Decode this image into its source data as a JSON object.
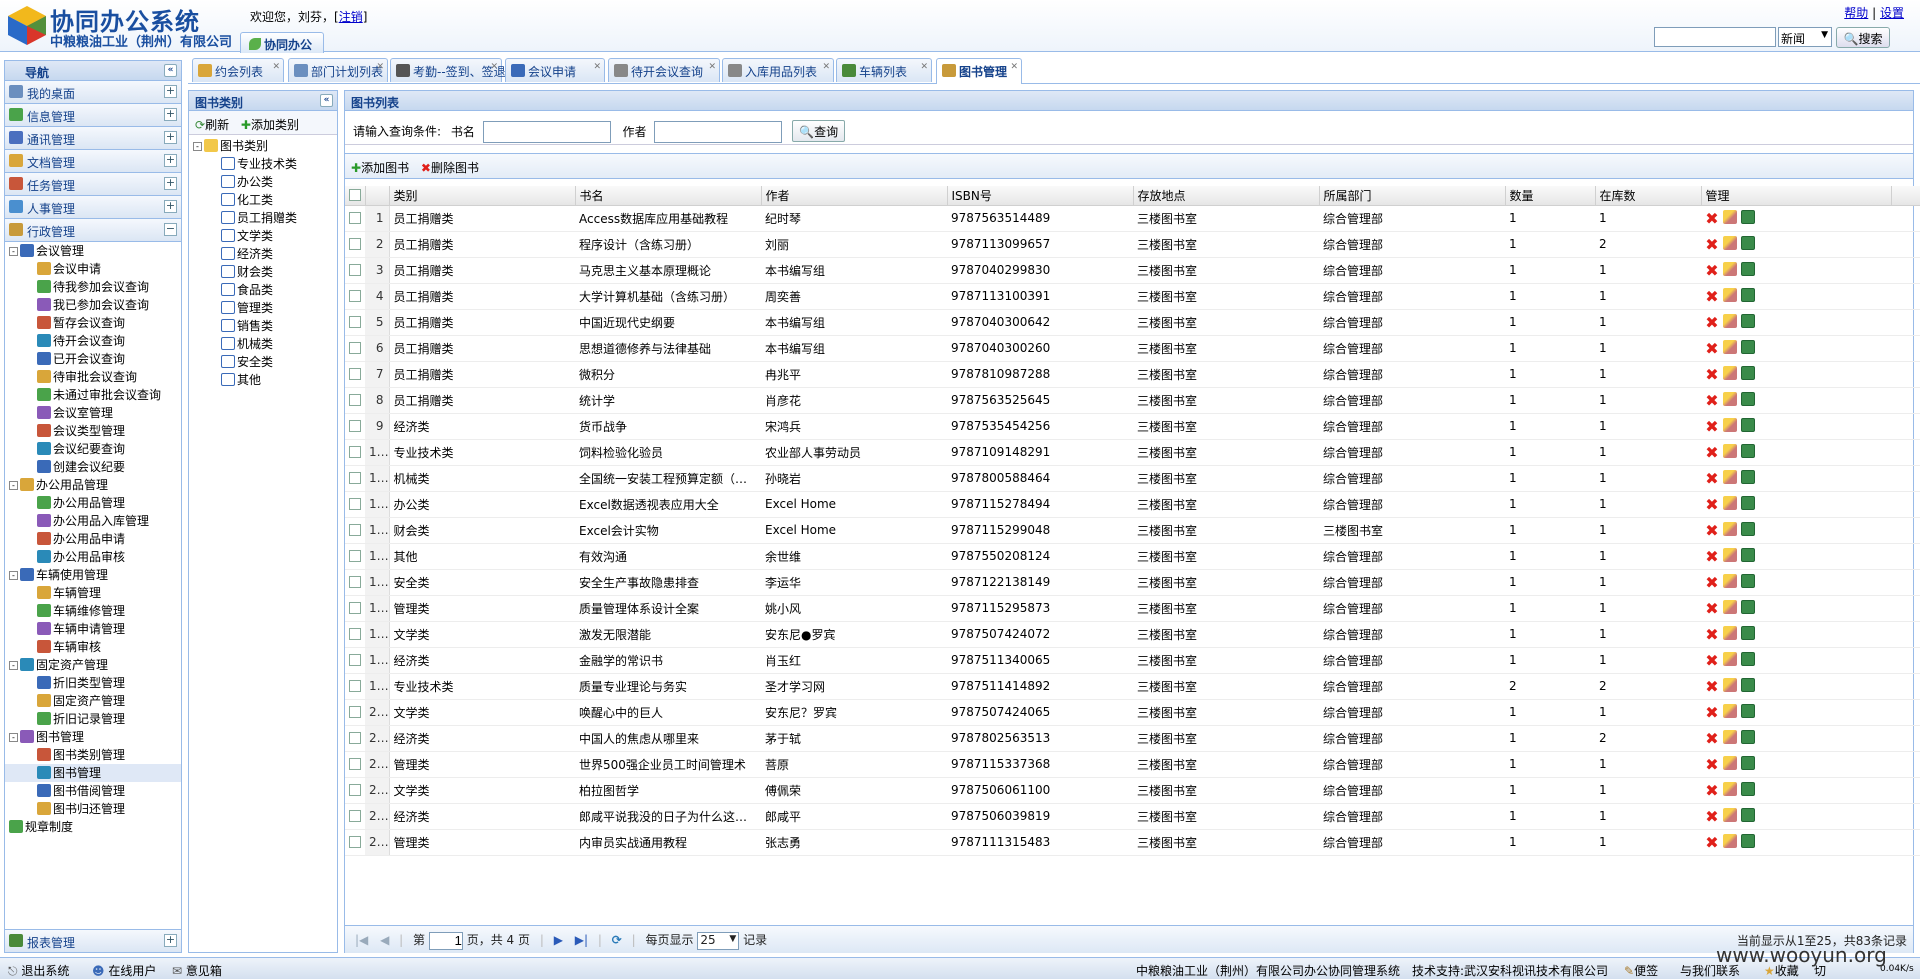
{
  "header": {
    "app_title": "协同办公系统",
    "company": "中粮粮油工业（荆州）有限公司",
    "welcome_prefix": "欢迎您，刘芬，[",
    "logout": "注销",
    "welcome_suffix": "]",
    "top_tab": "协同办公",
    "help": "帮助",
    "separator": "|",
    "settings": "设置",
    "search_placeholder": "",
    "search_scope": "新闻",
    "search_button": "搜索"
  },
  "nav": {
    "title": "导航",
    "sections": [
      {
        "label": "我的桌面",
        "icon": "desktop-icon",
        "color": "#6b8fbf"
      },
      {
        "label": "信息管理",
        "icon": "chat-icon",
        "color": "#4aa34a"
      },
      {
        "label": "通讯管理",
        "icon": "phone-icon",
        "color": "#4a6fbf"
      },
      {
        "label": "文档管理",
        "icon": "folder-icon",
        "color": "#d9a63a"
      },
      {
        "label": "任务管理",
        "icon": "task-icon",
        "color": "#c8563a"
      },
      {
        "label": "人事管理",
        "icon": "people-icon",
        "color": "#4a8fcf"
      },
      {
        "label": "行政管理",
        "icon": "book-icon",
        "color": "#c89a3a",
        "expanded": true
      }
    ],
    "tree": [
      {
        "label": "会议管理",
        "level": 1,
        "toggle": "-"
      },
      {
        "label": "会议申请",
        "level": 2
      },
      {
        "label": "待我参加会议查询",
        "level": 2
      },
      {
        "label": "我已参加会议查询",
        "level": 2
      },
      {
        "label": "暂存会议查询",
        "level": 2
      },
      {
        "label": "待开会议查询",
        "level": 2
      },
      {
        "label": "已开会议查询",
        "level": 2
      },
      {
        "label": "待审批会议查询",
        "level": 2
      },
      {
        "label": "未通过审批会议查询",
        "level": 2
      },
      {
        "label": "会议室管理",
        "level": 2
      },
      {
        "label": "会议类型管理",
        "level": 2
      },
      {
        "label": "会议纪要查询",
        "level": 2
      },
      {
        "label": "创建会议纪要",
        "level": 2
      },
      {
        "label": "办公用品管理",
        "level": 1,
        "toggle": "-"
      },
      {
        "label": "办公用品管理",
        "level": 2
      },
      {
        "label": "办公用品入库管理",
        "level": 2
      },
      {
        "label": "办公用品申请",
        "level": 2
      },
      {
        "label": "办公用品审核",
        "level": 2
      },
      {
        "label": "车辆使用管理",
        "level": 1,
        "toggle": "-"
      },
      {
        "label": "车辆管理",
        "level": 2
      },
      {
        "label": "车辆维修管理",
        "level": 2
      },
      {
        "label": "车辆申请管理",
        "level": 2
      },
      {
        "label": "车辆审核",
        "level": 2
      },
      {
        "label": "固定资产管理",
        "level": 1,
        "toggle": "-"
      },
      {
        "label": "折旧类型管理",
        "level": 2
      },
      {
        "label": "固定资产管理",
        "level": 2
      },
      {
        "label": "折旧记录管理",
        "level": 2
      },
      {
        "label": "图书管理",
        "level": 1,
        "toggle": "-"
      },
      {
        "label": "图书类别管理",
        "level": 2
      },
      {
        "label": "图书管理",
        "level": 2,
        "selected": true
      },
      {
        "label": "图书借阅管理",
        "level": 2
      },
      {
        "label": "图书归还管理",
        "level": 2
      },
      {
        "label": "规章制度",
        "level": 1
      }
    ],
    "bottom_section": "报表管理"
  },
  "tabs": [
    "约会列表",
    "部门计划列表",
    "考勤--签到、签退",
    "会议申请",
    "待开会议查询",
    "入库用品列表",
    "车辆列表",
    "图书管理"
  ],
  "category": {
    "title": "图书类别",
    "refresh": "刷新",
    "add": "添加类别",
    "root": "图书类别",
    "items": [
      "专业技术类",
      "办公类",
      "化工类",
      "员工捐赠类",
      "文学类",
      "经济类",
      "财会类",
      "食品类",
      "管理类",
      "销售类",
      "机械类",
      "安全类",
      "其他"
    ]
  },
  "main": {
    "title": "图书列表",
    "query_label": "请输入查询条件:",
    "name_label": "书名",
    "author_label": "作者",
    "name_value": "",
    "author_value": "",
    "query_button": "查询",
    "add_book": "添加图书",
    "delete_book": "删除图书",
    "columns": [
      "类别",
      "书名",
      "作者",
      "ISBN号",
      "存放地点",
      "所属部门",
      "数量",
      "在库数",
      "管理"
    ],
    "rows": [
      [
        "员工捐赠类",
        "Access数据库应用基础教程",
        "纪时琴",
        "9787563514489",
        "三楼图书室",
        "综合管理部",
        "1",
        "1"
      ],
      [
        "员工捐赠类",
        "程序设计（含练习册）",
        "刘丽",
        "9787113099657",
        "三楼图书室",
        "综合管理部",
        "1",
        "2"
      ],
      [
        "员工捐赠类",
        "马克思主义基本原理概论",
        "本书编写组",
        "9787040299830",
        "三楼图书室",
        "综合管理部",
        "1",
        "1"
      ],
      [
        "员工捐赠类",
        "大学计算机基础（含练习册）",
        "周奕善",
        "9787113100391",
        "三楼图书室",
        "综合管理部",
        "1",
        "1"
      ],
      [
        "员工捐赠类",
        "中国近现代史纲要",
        "本书编写组",
        "9787040300642",
        "三楼图书室",
        "综合管理部",
        "1",
        "1"
      ],
      [
        "员工捐赠类",
        "思想道德修养与法律基础",
        "本书编写组",
        "9787040300260",
        "三楼图书室",
        "综合管理部",
        "1",
        "1"
      ],
      [
        "员工捐赠类",
        "微积分",
        "冉兆平",
        "9787810987288",
        "三楼图书室",
        "综合管理部",
        "1",
        "1"
      ],
      [
        "员工捐赠类",
        "统计学",
        "肖彦花",
        "9787563525645",
        "三楼图书室",
        "综合管理部",
        "1",
        "1"
      ],
      [
        "经济类",
        "货币战争",
        "宋鸿兵",
        "9787535454256",
        "三楼图书室",
        "综合管理部",
        "1",
        "1"
      ],
      [
        "专业技术类",
        "饲料检验化验员",
        "农业部人事劳动员",
        "9787109148291",
        "三楼图书室",
        "综合管理部",
        "1",
        "1"
      ],
      [
        "机械类",
        "全国统一安装工程预算定额（…",
        "孙晓岩",
        "9787800588464",
        "三楼图书室",
        "综合管理部",
        "1",
        "1"
      ],
      [
        "办公类",
        "Excel数据透视表应用大全",
        "Excel Home",
        "9787115278494",
        "三楼图书室",
        "综合管理部",
        "1",
        "1"
      ],
      [
        "财会类",
        "Excel会计实物",
        "Excel Home",
        "9787115299048",
        "三楼图书室",
        "三楼图书室",
        "1",
        "1"
      ],
      [
        "其他",
        "有效沟通",
        "余世维",
        "9787550208124",
        "三楼图书室",
        "综合管理部",
        "1",
        "1"
      ],
      [
        "安全类",
        "安全生产事故隐患排查",
        "李运华",
        "9787122138149",
        "三楼图书室",
        "综合管理部",
        "1",
        "1"
      ],
      [
        "管理类",
        "质量管理体系设计全案",
        "姚小风",
        "9787115295873",
        "三楼图书室",
        "综合管理部",
        "1",
        "1"
      ],
      [
        "文学类",
        "激发无限潜能",
        "安东尼●罗宾",
        "9787507424072",
        "三楼图书室",
        "综合管理部",
        "1",
        "1"
      ],
      [
        "经济类",
        "金融学的常识书",
        "肖玉红",
        "9787511340065",
        "三楼图书室",
        "综合管理部",
        "1",
        "1"
      ],
      [
        "专业技术类",
        "质量专业理论与务实",
        "圣才学习网",
        "9787511414892",
        "三楼图书室",
        "综合管理部",
        "2",
        "2"
      ],
      [
        "文学类",
        "唤醒心中的巨人",
        "安东尼？罗宾",
        "9787507424065",
        "三楼图书室",
        "综合管理部",
        "1",
        "1"
      ],
      [
        "经济类",
        "中国人的焦虑从哪里来",
        "茅于轼",
        "9787802563513",
        "三楼图书室",
        "综合管理部",
        "1",
        "2"
      ],
      [
        "管理类",
        "世界500强企业员工时间管理术",
        "菩原",
        "9787115337368",
        "三楼图书室",
        "综合管理部",
        "1",
        "1"
      ],
      [
        "文学类",
        "柏拉图哲学",
        "傅佩荣",
        "9787506061100",
        "三楼图书室",
        "综合管理部",
        "1",
        "1"
      ],
      [
        "经济类",
        "郎咸平说我没的日子为什么这…",
        "郎咸平",
        "9787506039819",
        "三楼图书室",
        "综合管理部",
        "1",
        "1"
      ],
      [
        "管理类",
        "内审员实战通用教程",
        "张志勇",
        "9787111315483",
        "三楼图书室",
        "综合管理部",
        "1",
        "1"
      ]
    ],
    "pager": {
      "page_label": "第",
      "page": "1",
      "of_label": "页，共 4 页",
      "per_page_label": "每页显示",
      "per_page": "25",
      "records_label": "记录",
      "summary": "当前显示从1至25，共83条记录"
    }
  },
  "footer": {
    "logout": "退出系统",
    "online": "在线用户",
    "feedback": "意见箱",
    "system_name": "中粮粮油工业（荆州）有限公司办公协同管理系统",
    "support": "技术支持:武汉安科视讯技术有限公司",
    "note": "便签",
    "contact": "与我们联系",
    "fav": "收藏",
    "cut": "切",
    "speed": "0.04K/s",
    "watermark": "www.wooyun.org"
  }
}
